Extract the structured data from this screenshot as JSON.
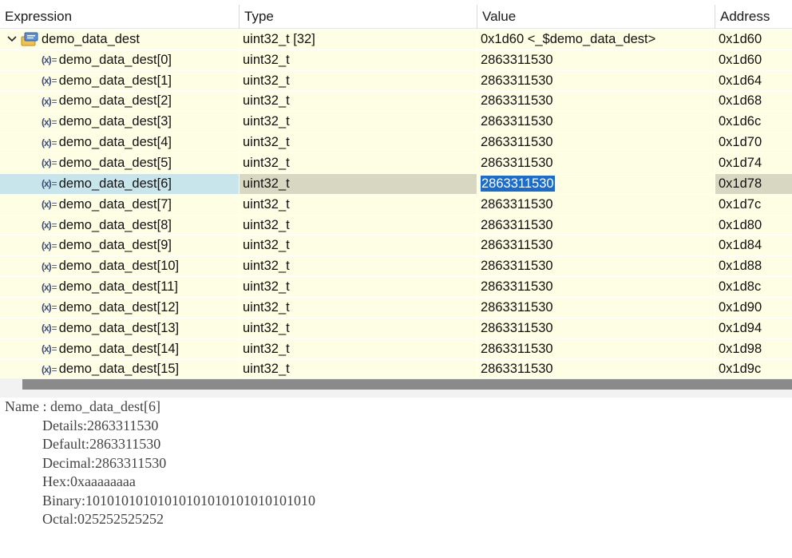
{
  "table": {
    "headers": {
      "expression": "Expression",
      "type": "Type",
      "value": "Value",
      "address": "Address"
    },
    "rows": [
      {
        "expression": "demo_data_dest",
        "type": "uint32_t [32]",
        "value": "0x1d60 <_$demo_data_dest>",
        "address": "0x1d60",
        "kind": "array",
        "expanded": true
      },
      {
        "expression": "demo_data_dest[0]",
        "type": "uint32_t",
        "value": "2863311530",
        "address": "0x1d60",
        "kind": "element"
      },
      {
        "expression": "demo_data_dest[1]",
        "type": "uint32_t",
        "value": "2863311530",
        "address": "0x1d64",
        "kind": "element"
      },
      {
        "expression": "demo_data_dest[2]",
        "type": "uint32_t",
        "value": "2863311530",
        "address": "0x1d68",
        "kind": "element"
      },
      {
        "expression": "demo_data_dest[3]",
        "type": "uint32_t",
        "value": "2863311530",
        "address": "0x1d6c",
        "kind": "element"
      },
      {
        "expression": "demo_data_dest[4]",
        "type": "uint32_t",
        "value": "2863311530",
        "address": "0x1d70",
        "kind": "element"
      },
      {
        "expression": "demo_data_dest[5]",
        "type": "uint32_t",
        "value": "2863311530",
        "address": "0x1d74",
        "kind": "element"
      },
      {
        "expression": "demo_data_dest[6]",
        "type": "uint32_t",
        "value": "2863311530",
        "address": "0x1d78",
        "kind": "element",
        "selected": true
      },
      {
        "expression": "demo_data_dest[7]",
        "type": "uint32_t",
        "value": "2863311530",
        "address": "0x1d7c",
        "kind": "element"
      },
      {
        "expression": "demo_data_dest[8]",
        "type": "uint32_t",
        "value": "2863311530",
        "address": "0x1d80",
        "kind": "element"
      },
      {
        "expression": "demo_data_dest[9]",
        "type": "uint32_t",
        "value": "2863311530",
        "address": "0x1d84",
        "kind": "element"
      },
      {
        "expression": "demo_data_dest[10]",
        "type": "uint32_t",
        "value": "2863311530",
        "address": "0x1d88",
        "kind": "element"
      },
      {
        "expression": "demo_data_dest[11]",
        "type": "uint32_t",
        "value": "2863311530",
        "address": "0x1d8c",
        "kind": "element"
      },
      {
        "expression": "demo_data_dest[12]",
        "type": "uint32_t",
        "value": "2863311530",
        "address": "0x1d90",
        "kind": "element"
      },
      {
        "expression": "demo_data_dest[13]",
        "type": "uint32_t",
        "value": "2863311530",
        "address": "0x1d94",
        "kind": "element"
      },
      {
        "expression": "demo_data_dest[14]",
        "type": "uint32_t",
        "value": "2863311530",
        "address": "0x1d98",
        "kind": "element"
      },
      {
        "expression": "demo_data_dest[15]",
        "type": "uint32_t",
        "value": "2863311530",
        "address": "0x1d9c",
        "kind": "element"
      }
    ]
  },
  "details": {
    "name_line": "Name : demo_data_dest[6]",
    "lines": [
      "Details:2863311530",
      "Default:2863311530",
      "Decimal:2863311530",
      "Hex:0xaaaaaaaa",
      "Binary:10101010101010101010101010101010",
      "Octal:025252525252"
    ]
  },
  "icons": {
    "expand": "chevron-down-icon",
    "array": "struct-variable-icon",
    "element": "variable-icon"
  },
  "colors": {
    "row_background": "#fefee4",
    "selected_expression_background": "#c9e5ec",
    "selected_cell_background": "#d8d8c2",
    "selection_highlight": "#1b6ccf"
  }
}
